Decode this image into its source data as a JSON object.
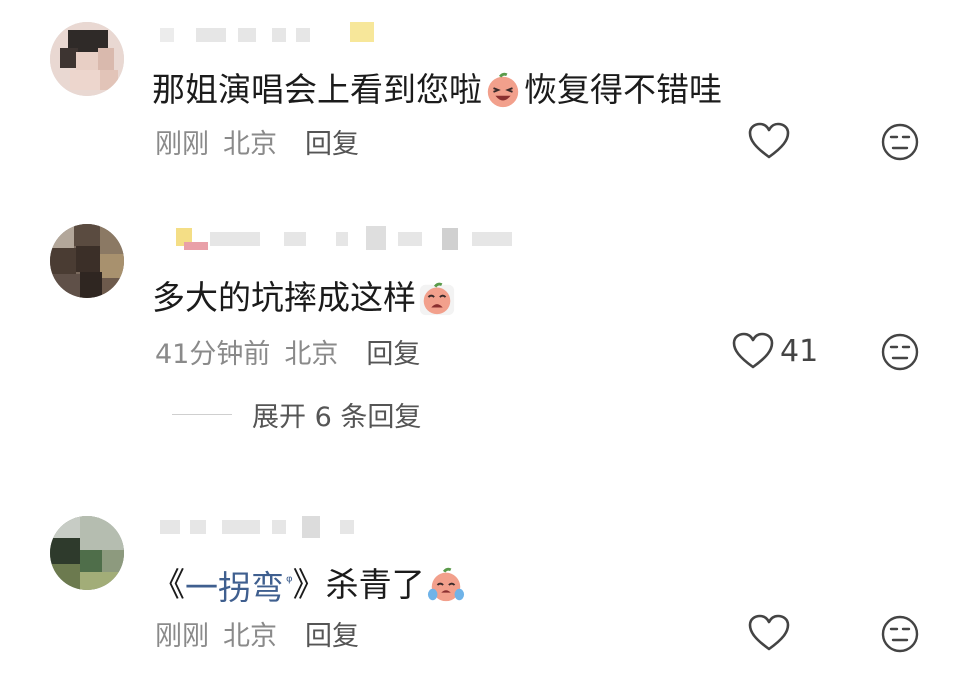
{
  "comments": [
    {
      "text_before": "那姐演唱会上看到您啦",
      "emoji": "laughing-peach-emoji",
      "text_after": "恢复得不错哇",
      "time": "刚刚",
      "location": "北京",
      "reply_label": "回复",
      "like_count": ""
    },
    {
      "text_before": "多大的坑摔成这样",
      "emoji": "crying-peach-emoji",
      "text_after": "",
      "time": "41分钟前",
      "location": "北京",
      "reply_label": "回复",
      "like_count": "41",
      "expand_label": "展开 6 条回复"
    },
    {
      "text_open": "《",
      "work_title": "一拐弯",
      "work_icon": "search-icon",
      "text_close": "》",
      "text_after": "杀青了",
      "emoji": "tearful-peach-emoji",
      "time": "刚刚",
      "location": "北京",
      "reply_label": "回复",
      "like_count": ""
    }
  ],
  "icons": {
    "like": "heart-outline-icon",
    "dislike": "neutral-face-icon"
  },
  "colors": {
    "text": "#1b1b1b",
    "meta": "#8a8a8a",
    "link": "#3f5f8f",
    "icon": "#444444"
  }
}
